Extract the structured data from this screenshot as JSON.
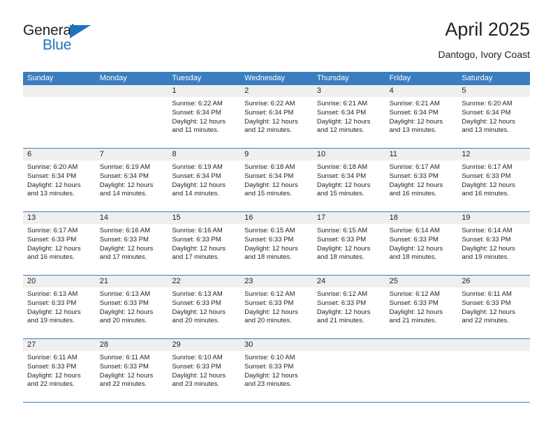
{
  "brand": {
    "word_general": "General",
    "word_blue": "Blue",
    "triangle_color": "#1f72bd"
  },
  "header": {
    "title": "April 2025",
    "subtitle": "Dantogo, Ivory Coast"
  },
  "colors": {
    "header_row_bg": "#3a7ebf",
    "day_number_bg": "#efefef",
    "text": "#231f20",
    "grid_line": "#3a7ebf"
  },
  "weekdays": [
    "Sunday",
    "Monday",
    "Tuesday",
    "Wednesday",
    "Thursday",
    "Friday",
    "Saturday"
  ],
  "weeks": [
    [
      {
        "day": "",
        "lines": []
      },
      {
        "day": "",
        "lines": []
      },
      {
        "day": "1",
        "lines": [
          "Sunrise: 6:22 AM",
          "Sunset: 6:34 PM",
          "Daylight: 12 hours",
          "and 11 minutes."
        ]
      },
      {
        "day": "2",
        "lines": [
          "Sunrise: 6:22 AM",
          "Sunset: 6:34 PM",
          "Daylight: 12 hours",
          "and 12 minutes."
        ]
      },
      {
        "day": "3",
        "lines": [
          "Sunrise: 6:21 AM",
          "Sunset: 6:34 PM",
          "Daylight: 12 hours",
          "and 12 minutes."
        ]
      },
      {
        "day": "4",
        "lines": [
          "Sunrise: 6:21 AM",
          "Sunset: 6:34 PM",
          "Daylight: 12 hours",
          "and 13 minutes."
        ]
      },
      {
        "day": "5",
        "lines": [
          "Sunrise: 6:20 AM",
          "Sunset: 6:34 PM",
          "Daylight: 12 hours",
          "and 13 minutes."
        ]
      }
    ],
    [
      {
        "day": "6",
        "lines": [
          "Sunrise: 6:20 AM",
          "Sunset: 6:34 PM",
          "Daylight: 12 hours",
          "and 13 minutes."
        ]
      },
      {
        "day": "7",
        "lines": [
          "Sunrise: 6:19 AM",
          "Sunset: 6:34 PM",
          "Daylight: 12 hours",
          "and 14 minutes."
        ]
      },
      {
        "day": "8",
        "lines": [
          "Sunrise: 6:19 AM",
          "Sunset: 6:34 PM",
          "Daylight: 12 hours",
          "and 14 minutes."
        ]
      },
      {
        "day": "9",
        "lines": [
          "Sunrise: 6:18 AM",
          "Sunset: 6:34 PM",
          "Daylight: 12 hours",
          "and 15 minutes."
        ]
      },
      {
        "day": "10",
        "lines": [
          "Sunrise: 6:18 AM",
          "Sunset: 6:34 PM",
          "Daylight: 12 hours",
          "and 15 minutes."
        ]
      },
      {
        "day": "11",
        "lines": [
          "Sunrise: 6:17 AM",
          "Sunset: 6:33 PM",
          "Daylight: 12 hours",
          "and 16 minutes."
        ]
      },
      {
        "day": "12",
        "lines": [
          "Sunrise: 6:17 AM",
          "Sunset: 6:33 PM",
          "Daylight: 12 hours",
          "and 16 minutes."
        ]
      }
    ],
    [
      {
        "day": "13",
        "lines": [
          "Sunrise: 6:17 AM",
          "Sunset: 6:33 PM",
          "Daylight: 12 hours",
          "and 16 minutes."
        ]
      },
      {
        "day": "14",
        "lines": [
          "Sunrise: 6:16 AM",
          "Sunset: 6:33 PM",
          "Daylight: 12 hours",
          "and 17 minutes."
        ]
      },
      {
        "day": "15",
        "lines": [
          "Sunrise: 6:16 AM",
          "Sunset: 6:33 PM",
          "Daylight: 12 hours",
          "and 17 minutes."
        ]
      },
      {
        "day": "16",
        "lines": [
          "Sunrise: 6:15 AM",
          "Sunset: 6:33 PM",
          "Daylight: 12 hours",
          "and 18 minutes."
        ]
      },
      {
        "day": "17",
        "lines": [
          "Sunrise: 6:15 AM",
          "Sunset: 6:33 PM",
          "Daylight: 12 hours",
          "and 18 minutes."
        ]
      },
      {
        "day": "18",
        "lines": [
          "Sunrise: 6:14 AM",
          "Sunset: 6:33 PM",
          "Daylight: 12 hours",
          "and 18 minutes."
        ]
      },
      {
        "day": "19",
        "lines": [
          "Sunrise: 6:14 AM",
          "Sunset: 6:33 PM",
          "Daylight: 12 hours",
          "and 19 minutes."
        ]
      }
    ],
    [
      {
        "day": "20",
        "lines": [
          "Sunrise: 6:13 AM",
          "Sunset: 6:33 PM",
          "Daylight: 12 hours",
          "and 19 minutes."
        ]
      },
      {
        "day": "21",
        "lines": [
          "Sunrise: 6:13 AM",
          "Sunset: 6:33 PM",
          "Daylight: 12 hours",
          "and 20 minutes."
        ]
      },
      {
        "day": "22",
        "lines": [
          "Sunrise: 6:13 AM",
          "Sunset: 6:33 PM",
          "Daylight: 12 hours",
          "and 20 minutes."
        ]
      },
      {
        "day": "23",
        "lines": [
          "Sunrise: 6:12 AM",
          "Sunset: 6:33 PM",
          "Daylight: 12 hours",
          "and 20 minutes."
        ]
      },
      {
        "day": "24",
        "lines": [
          "Sunrise: 6:12 AM",
          "Sunset: 6:33 PM",
          "Daylight: 12 hours",
          "and 21 minutes."
        ]
      },
      {
        "day": "25",
        "lines": [
          "Sunrise: 6:12 AM",
          "Sunset: 6:33 PM",
          "Daylight: 12 hours",
          "and 21 minutes."
        ]
      },
      {
        "day": "26",
        "lines": [
          "Sunrise: 6:11 AM",
          "Sunset: 6:33 PM",
          "Daylight: 12 hours",
          "and 22 minutes."
        ]
      }
    ],
    [
      {
        "day": "27",
        "lines": [
          "Sunrise: 6:11 AM",
          "Sunset: 6:33 PM",
          "Daylight: 12 hours",
          "and 22 minutes."
        ]
      },
      {
        "day": "28",
        "lines": [
          "Sunrise: 6:11 AM",
          "Sunset: 6:33 PM",
          "Daylight: 12 hours",
          "and 22 minutes."
        ]
      },
      {
        "day": "29",
        "lines": [
          "Sunrise: 6:10 AM",
          "Sunset: 6:33 PM",
          "Daylight: 12 hours",
          "and 23 minutes."
        ]
      },
      {
        "day": "30",
        "lines": [
          "Sunrise: 6:10 AM",
          "Sunset: 6:33 PM",
          "Daylight: 12 hours",
          "and 23 minutes."
        ]
      },
      {
        "day": "",
        "lines": []
      },
      {
        "day": "",
        "lines": []
      },
      {
        "day": "",
        "lines": []
      }
    ]
  ]
}
